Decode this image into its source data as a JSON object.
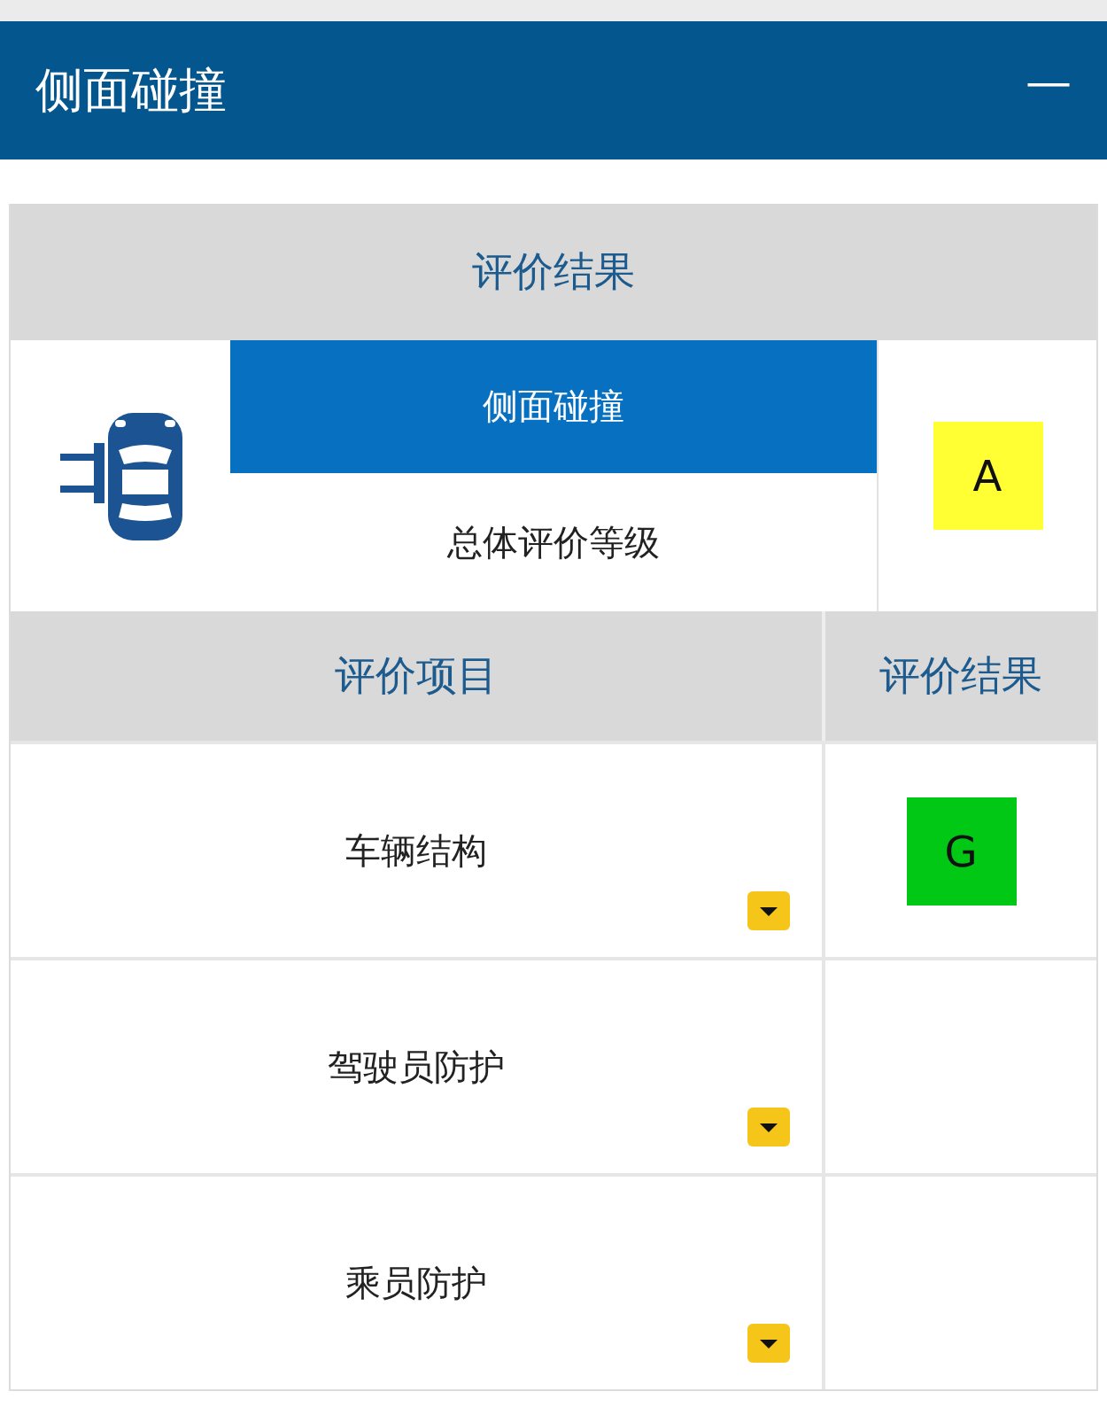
{
  "header": {
    "title": "侧面碰撞",
    "collapse_symbol": "—"
  },
  "summary": {
    "heading": "评价结果",
    "labels": [
      {
        "text": "侧面碰撞",
        "selected": true
      },
      {
        "text": "总体评价等级",
        "selected": false
      }
    ],
    "grade": {
      "text": "A",
      "color": "#ffff33"
    }
  },
  "table": {
    "columns": [
      "评价项目",
      "评价结果"
    ],
    "rows": [
      {
        "item": "车辆结构",
        "result": {
          "text": "G",
          "color": "#00c814"
        }
      },
      {
        "item": "驾驶员防护"
      },
      {
        "item": "乘员防护"
      }
    ]
  }
}
